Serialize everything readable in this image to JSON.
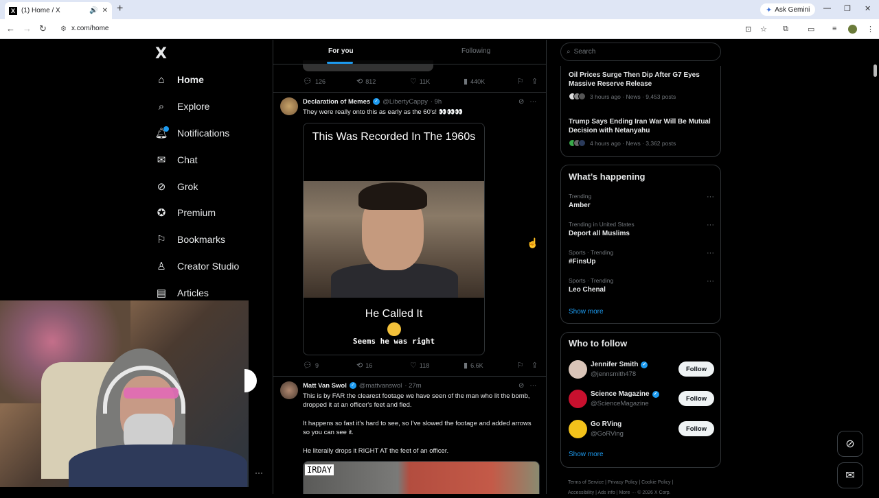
{
  "browser": {
    "tab_title": "(1) Home / X",
    "tab_favicon": "X",
    "url": "x.com/home",
    "ask_gemini": "Ask Gemini"
  },
  "sidebar": {
    "logo": "X",
    "items": [
      {
        "label": "Home",
        "icon": "home-icon"
      },
      {
        "label": "Explore",
        "icon": "search-icon"
      },
      {
        "label": "Notifications",
        "icon": "bell-icon"
      },
      {
        "label": "Chat",
        "icon": "mail-icon"
      },
      {
        "label": "Grok",
        "icon": "grok-icon"
      },
      {
        "label": "Premium",
        "icon": "premium-icon"
      },
      {
        "label": "Bookmarks",
        "icon": "bookmark-icon"
      },
      {
        "label": "Creator Studio",
        "icon": "creator-icon"
      },
      {
        "label": "Articles",
        "icon": "articles-icon"
      }
    ],
    "notif_count": "1"
  },
  "feed": {
    "tabs": [
      "For you",
      "Following"
    ],
    "prev_post_actions": {
      "replies": "126",
      "reposts": "812",
      "likes": "11K",
      "views": "440K"
    },
    "post1": {
      "name": "Declaration of Memes",
      "handle": "@LibertyCappy",
      "time": "· 9h",
      "text": "They were really onto this as early as the 60's! 👀👀👀",
      "media_top": "This Was Recorded In The 1960s",
      "media_bottom1": "He Called It",
      "media_bottom2": "Seems he was right",
      "actions": {
        "replies": "9",
        "reposts": "16",
        "likes": "118",
        "views": "6.6K"
      }
    },
    "post2": {
      "name": "Matt Van Swol",
      "handle": "@mattvanswol",
      "time": "· 27m",
      "text1": "This is by FAR the clearest footage we have seen of the man who lit the bomb, dropped it at an officer's feet and fled.",
      "text2": "It happens so fast it's hard to see, so I've slowed the footage and added arrows so you can see it.",
      "text3": "He literally drops it RIGHT AT the feet of an officer.",
      "media_label": "IRDAY"
    }
  },
  "right": {
    "search_placeholder": "Search",
    "news": [
      {
        "title": "Oil Prices Surge Then Dip After G7 Eyes Massive Reserve Release",
        "meta": "3 hours ago · News · 9,453 posts"
      },
      {
        "title": "Trump Says Ending Iran War Will Be Mutual Decision with Netanyahu",
        "meta": "4 hours ago · News · 3,362 posts"
      }
    ],
    "happening_title": "What’s happening",
    "trends": [
      {
        "context": "Trending",
        "title": "Amber"
      },
      {
        "context": "Trending in United States",
        "title": "Deport all Muslims"
      },
      {
        "context": "Sports · Trending",
        "title": "#FinsUp"
      },
      {
        "context": "Sports · Trending",
        "title": "Leo Chenal"
      }
    ],
    "show_more": "Show more",
    "follow_title": "Who to follow",
    "follow": [
      {
        "name": "Jennifer Smith",
        "handle": "@jennsmith478",
        "btn": "Follow",
        "color": "#d9c4b8"
      },
      {
        "name": "Science Magazine",
        "handle": "@ScienceMagazine",
        "btn": "Follow",
        "color": "#c8102e"
      },
      {
        "name": "Go RVing",
        "handle": "@GoRVing",
        "btn": "Follow",
        "color": "#f2c21b"
      }
    ],
    "show_more2": "Show more",
    "footer1": "Terms of Service  |  Privacy Policy  |  Cookie Policy  |",
    "footer2": "Accessibility  |  Ads info  |  More ···  © 2026 X Corp."
  }
}
